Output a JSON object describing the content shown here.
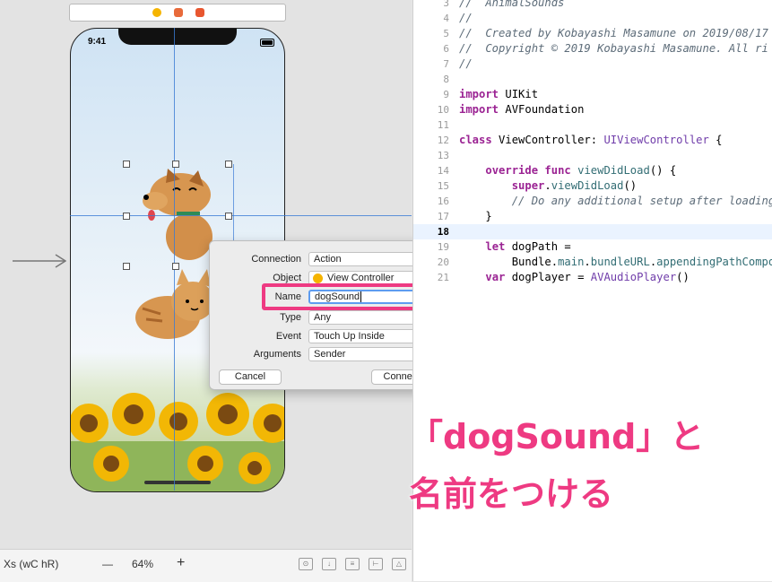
{
  "canvas": {
    "status_time": "9:41"
  },
  "popup": {
    "rows": [
      {
        "label": "Connection",
        "value": "Action"
      },
      {
        "label": "Object",
        "value": "View Controller"
      },
      {
        "label": "Name",
        "value": "dogSound"
      },
      {
        "label": "Type",
        "value": "Any"
      },
      {
        "label": "Event",
        "value": "Touch Up Inside"
      },
      {
        "label": "Arguments",
        "value": "Sender"
      }
    ],
    "cancel_label": "Cancel",
    "connect_label": "Connect"
  },
  "editor": {
    "lines": [
      {
        "num": "3",
        "text": "//  AnimalSounds",
        "kind": "comment"
      },
      {
        "num": "4",
        "text": "//",
        "kind": "comment"
      },
      {
        "num": "5",
        "text": "//  Created by Kobayashi Masamune on 2019/08/17",
        "kind": "comment"
      },
      {
        "num": "6",
        "text": "//  Copyright © 2019 Kobayashi Masamune. All ri",
        "kind": "comment"
      },
      {
        "num": "7",
        "text": "//",
        "kind": "comment"
      },
      {
        "num": "8",
        "text": "",
        "kind": "plain"
      },
      {
        "num": "9",
        "text": "import UIKit",
        "kind": "code"
      },
      {
        "num": "10",
        "text": "import AVFoundation",
        "kind": "code"
      },
      {
        "num": "11",
        "text": "",
        "kind": "plain"
      },
      {
        "num": "12",
        "text": "class ViewController: UIViewController {",
        "kind": "code"
      },
      {
        "num": "13",
        "text": "",
        "kind": "plain"
      },
      {
        "num": "14",
        "text": "    override func viewDidLoad() {",
        "kind": "code"
      },
      {
        "num": "15",
        "text": "        super.viewDidLoad()",
        "kind": "code"
      },
      {
        "num": "16",
        "text": "        // Do any additional setup after loading",
        "kind": "comment"
      },
      {
        "num": "17",
        "text": "    }",
        "kind": "code"
      },
      {
        "num": "18",
        "text": "",
        "kind": "plain"
      },
      {
        "num": "19",
        "text": "    let dogPath =",
        "kind": "code"
      },
      {
        "num": "20",
        "text": "        Bundle.main.bundleURL.appendingPathCompo",
        "kind": "code"
      },
      {
        "num": "21",
        "text": "    var dogPlayer = AVAudioPlayer()",
        "kind": "code"
      }
    ],
    "active_line": "18"
  },
  "annotation": {
    "line1": "「dogSound」と",
    "line2": "名前をつける",
    "color": "#ee3a82"
  },
  "bottom_bar": {
    "device": "Xs (wC hR)",
    "zoom_out": "—",
    "zoom_level": "64%",
    "zoom_in": "+"
  }
}
